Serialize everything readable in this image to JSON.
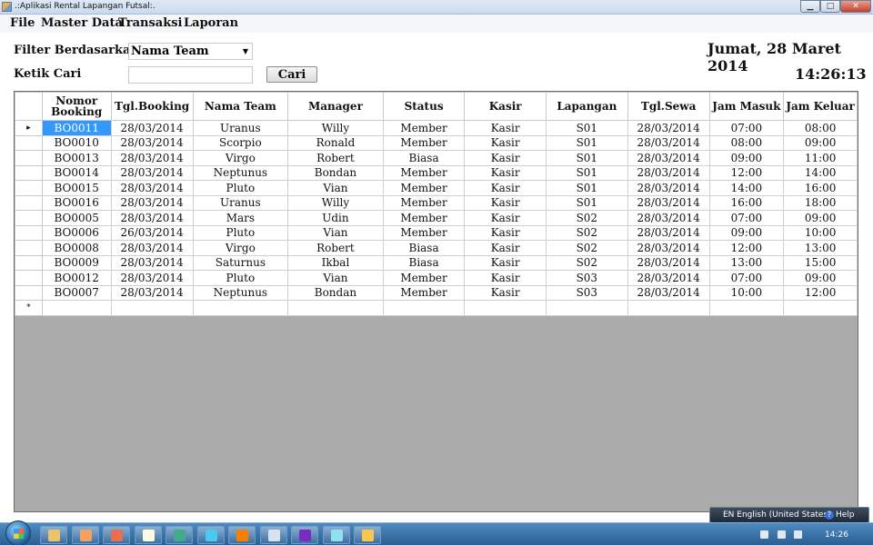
{
  "window": {
    "title": ".:Aplikasi Rental Lapangan Futsal:."
  },
  "menu": {
    "items": [
      "File",
      "Master Data",
      "Transaksi",
      "Laporan"
    ]
  },
  "filter": {
    "label": "Filter Berdasarkan",
    "selected": "Nama Team",
    "search_label": "Ketik Cari",
    "search_value": "",
    "search_button": "Cari"
  },
  "clock": {
    "date": "Jumat, 28 Maret 2014",
    "time": "14:26:13"
  },
  "grid": {
    "columns": [
      "Nomor Booking",
      "Tgl.Booking",
      "Nama Team",
      "Manager",
      "Status",
      "Kasir",
      "Lapangan",
      "Tgl.Sewa",
      "Jam Masuk",
      "Jam Keluar"
    ],
    "rows": [
      [
        "BO0011",
        "28/03/2014",
        "Uranus",
        "Willy",
        "Member",
        "Kasir",
        "S01",
        "28/03/2014",
        "07:00",
        "08:00"
      ],
      [
        "BO0010",
        "28/03/2014",
        "Scorpio",
        "Ronald",
        "Member",
        "Kasir",
        "S01",
        "28/03/2014",
        "08:00",
        "09:00"
      ],
      [
        "BO0013",
        "28/03/2014",
        "Virgo",
        "Robert",
        "Biasa",
        "Kasir",
        "S01",
        "28/03/2014",
        "09:00",
        "11:00"
      ],
      [
        "BO0014",
        "28/03/2014",
        "Neptunus",
        "Bondan",
        "Member",
        "Kasir",
        "S01",
        "28/03/2014",
        "12:00",
        "14:00"
      ],
      [
        "BO0015",
        "28/03/2014",
        "Pluto",
        "Vian",
        "Member",
        "Kasir",
        "S01",
        "28/03/2014",
        "14:00",
        "16:00"
      ],
      [
        "BO0016",
        "28/03/2014",
        "Uranus",
        "Willy",
        "Member",
        "Kasir",
        "S01",
        "28/03/2014",
        "16:00",
        "18:00"
      ],
      [
        "BO0005",
        "28/03/2014",
        "Mars",
        "Udin",
        "Member",
        "Kasir",
        "S02",
        "28/03/2014",
        "07:00",
        "09:00"
      ],
      [
        "BO0006",
        "26/03/2014",
        "Pluto",
        "Vian",
        "Member",
        "Kasir",
        "S02",
        "28/03/2014",
        "09:00",
        "10:00"
      ],
      [
        "BO0008",
        "28/03/2014",
        "Virgo",
        "Robert",
        "Biasa",
        "Kasir",
        "S02",
        "28/03/2014",
        "12:00",
        "13:00"
      ],
      [
        "BO0009",
        "28/03/2014",
        "Saturnus",
        "Ikbal",
        "Biasa",
        "Kasir",
        "S02",
        "28/03/2014",
        "13:00",
        "15:00"
      ],
      [
        "BO0012",
        "28/03/2014",
        "Pluto",
        "Vian",
        "Member",
        "Kasir",
        "S03",
        "28/03/2014",
        "07:00",
        "09:00"
      ],
      [
        "BO0007",
        "28/03/2014",
        "Neptunus",
        "Bondan",
        "Member",
        "Kasir",
        "S03",
        "28/03/2014",
        "10:00",
        "12:00"
      ]
    ],
    "current_row_marker": "▸",
    "new_row_marker": "*",
    "selected_row": 0
  },
  "langbar": {
    "language": "EN English (United States)",
    "help": "Help"
  },
  "taskbar": {
    "clock": "14:26",
    "apps": [
      {
        "icon": "explorer-icon",
        "color": "#e9c46a"
      },
      {
        "icon": "media-player-icon",
        "color": "#f4a261"
      },
      {
        "icon": "firefox-icon",
        "color": "#e76f51"
      },
      {
        "icon": "notepad-icon",
        "color": "#fefae0"
      },
      {
        "icon": "chrome-icon",
        "color": "#43aa8b"
      },
      {
        "icon": "skype-icon",
        "color": "#4cc9f0"
      },
      {
        "icon": "xampp-icon",
        "color": "#f77f00"
      },
      {
        "icon": "document-icon",
        "color": "#d9e3f0"
      },
      {
        "icon": "visual-studio-icon",
        "color": "#7b2cbf"
      },
      {
        "icon": "network-icon",
        "color": "#90e0ef"
      },
      {
        "icon": "futsal-app-icon",
        "color": "#f9c74f"
      }
    ]
  }
}
